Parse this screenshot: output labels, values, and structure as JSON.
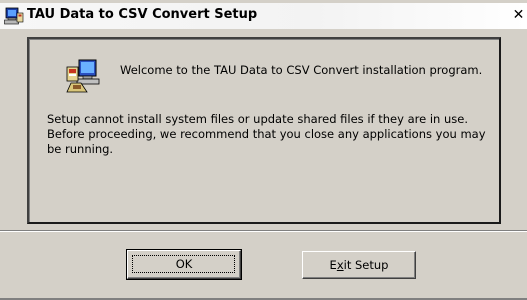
{
  "window": {
    "title": "TAU Data to CSV Convert Setup",
    "close_glyph": "✕"
  },
  "panel": {
    "welcome": "Welcome to the TAU Data to CSV Convert installation program.",
    "info": "Setup cannot install system files or update shared files if they are in use. Before proceeding, we recommend that you close any applications you may be running."
  },
  "buttons": {
    "ok_label": "OK",
    "exit_pre": "E",
    "exit_underlined": "x",
    "exit_post": "it Setup"
  },
  "icons": {
    "title": "setup-computer-icon",
    "panel": "setup-computer-icon",
    "close": "close-icon"
  },
  "colors": {
    "window_face": "#d4d0c8",
    "panel_border": "#404040"
  }
}
